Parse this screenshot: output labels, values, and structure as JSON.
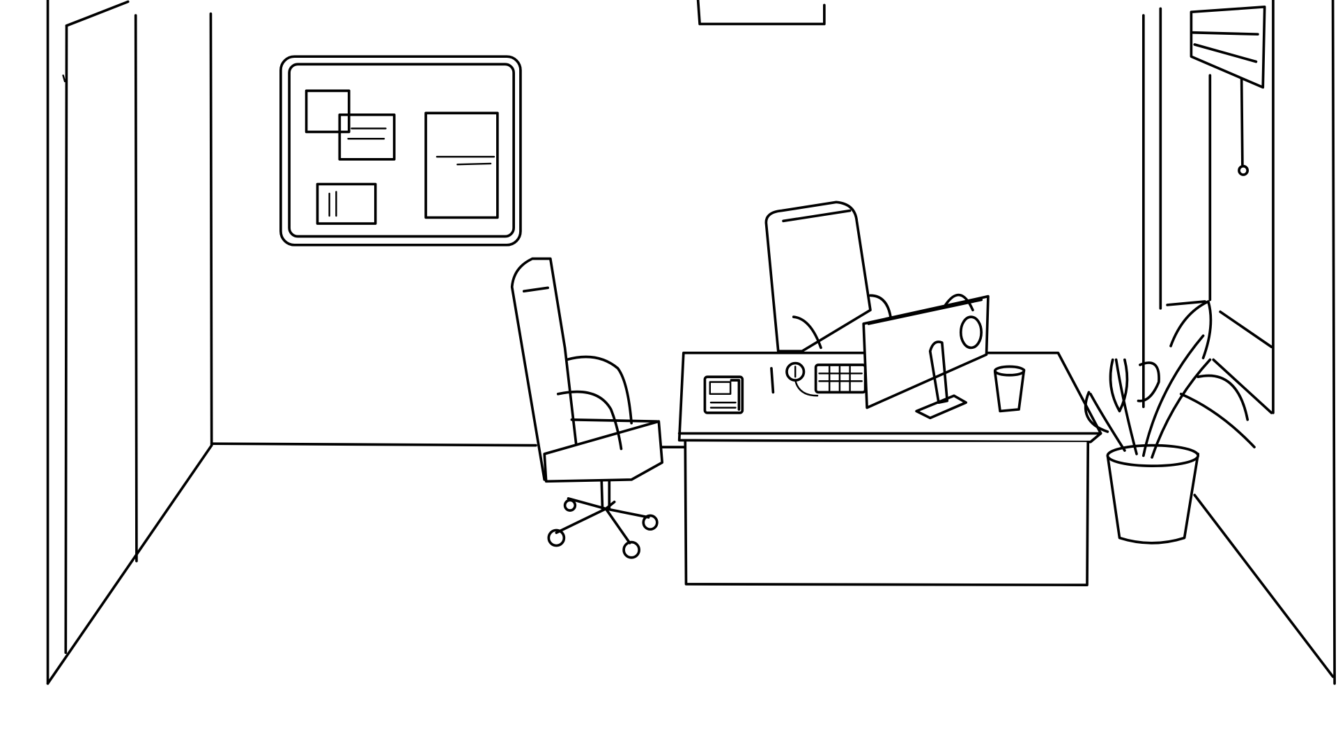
{
  "scene": {
    "style": "black line sketch on white",
    "colors": {
      "background": "#ffffff",
      "line": "#000000"
    },
    "objects": [
      "office-room",
      "left-door",
      "right-door",
      "bulletin-board",
      "ceiling-light",
      "hanging-sign",
      "visitor-chair",
      "office-chair",
      "desk",
      "desk-phone",
      "pen",
      "desk-mouse",
      "keyboard",
      "monitor",
      "headphones",
      "coffee-cup",
      "potted-plant"
    ]
  }
}
